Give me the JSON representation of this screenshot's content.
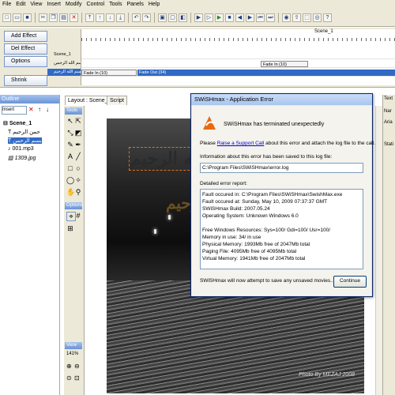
{
  "menu": [
    "File",
    "Edit",
    "View",
    "Insert",
    "Modify",
    "Control",
    "Tools",
    "Panels",
    "Help"
  ],
  "timeline": {
    "buttons": {
      "add_effect": "Add Effect",
      "del_effect": "Del Effect",
      "options": "Options",
      "shrink": "Shrink"
    },
    "scene_label": "Scene_1",
    "layers": [
      "Scene_1",
      "بسم الله الرحمن",
      "بسم الله الرحيم"
    ],
    "effects": [
      "Fade In (10)",
      "Fade In (10)",
      "Fade Out (34)"
    ]
  },
  "outline": {
    "title": "Outline",
    "dropdown": "Insert",
    "items": [
      "Scene_1",
      "حمن الرحيم",
      "بسم الرحمن",
      "001.mp3",
      "1309.jpg"
    ]
  },
  "layout": {
    "tabs": [
      "Layout : Scene_1",
      "Script"
    ],
    "tools_title": "Tools",
    "options_title": "Options",
    "view_title": "View",
    "zoom": "141%",
    "arabic_top": "بسم الله الرحيم",
    "arabic_mid": "الرحيم",
    "photo_credit": "Photo By MEZAJ 2008"
  },
  "right_panel": {
    "tab": "Text",
    "labels": [
      "Nar",
      "Aria",
      "Stati"
    ]
  },
  "dialog": {
    "title": "SWiSHmax - Application Error",
    "headline": "SWiSHmax has terminated unexpectedly",
    "please_pre": "Please",
    "link": "Raise a Support Call",
    "please_post": "about this error and attach the log file to the call.",
    "log_info": "Information about this error has been saved to this log file:",
    "log_path": "C:\\Program Files\\SWiSHmax\\error.log",
    "detail_label": "Detailed error report:",
    "report": [
      "Fault occured in: C:\\Program Files\\SWiSHmax\\SwishMax.exe",
      "Fault occured at: Sunday, May 10, 2009 07:37:37 GMT",
      "SWiSHmax Build: 2007.05.24",
      "Operating System: Unknown Windows 6.0",
      "",
      "Free Windows Resources: Sys=100/ Gdi=100/ Usr=100/",
      "Memory in use: 34/ in use",
      "Physical Memory: 1993Mb free of 2047Mb total",
      "Paging File: 4095Mb free of 4095Mb total",
      "Virtual Memory: 1941Mb free of 2047Mb total"
    ],
    "footer": "SWiSHmax will now attempt to save any unsaved movies...",
    "continue": "Continue"
  }
}
